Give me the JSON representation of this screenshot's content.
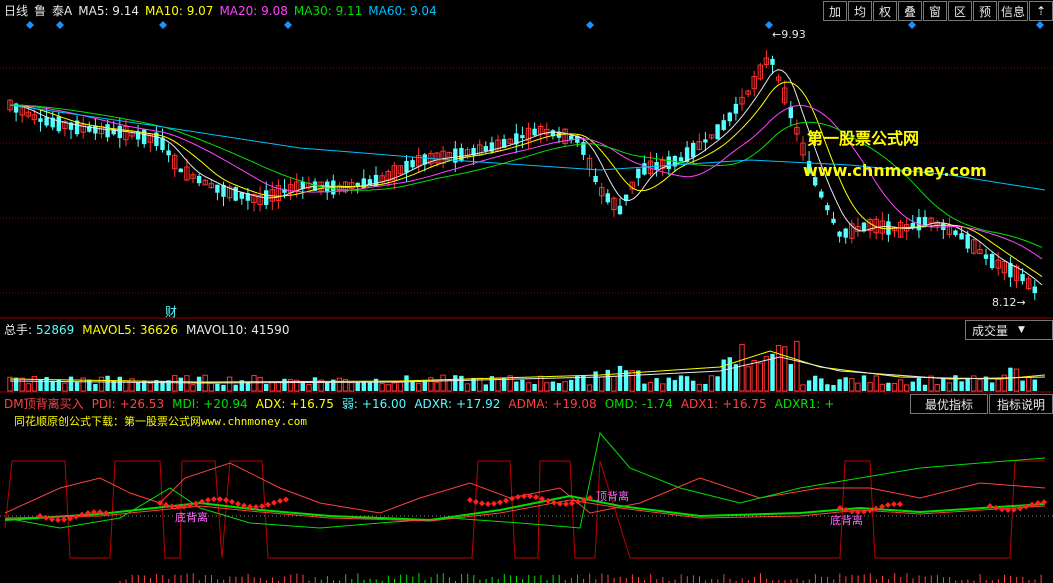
{
  "header": {
    "period": "日线",
    "stock_code": "鲁",
    "stock_name": "泰A",
    "ma": [
      {
        "label": "MA5:",
        "value": "9.14",
        "color": "#e8e8e8"
      },
      {
        "label": "MA10:",
        "value": "9.07",
        "color": "#ffff00"
      },
      {
        "label": "MA20:",
        "value": "9.08",
        "color": "#ff44ff"
      },
      {
        "label": "MA30:",
        "value": "9.11",
        "color": "#00e000"
      },
      {
        "label": "MA60:",
        "value": "9.04",
        "color": "#00c0ff"
      }
    ]
  },
  "toolbar": {
    "buttons": [
      "加",
      "均",
      "权",
      "叠",
      "窗",
      "区",
      "预",
      "信息"
    ]
  },
  "price_chart": {
    "high_label": "9.93",
    "low_label": "8.12",
    "finance_marker": "财",
    "watermark_title": "第一股票公式网",
    "watermark_url": "www.chnmoney.com"
  },
  "volume_panel": {
    "label": "总手:",
    "value": "52869",
    "mavol5_label": "MAVOL5:",
    "mavol5_value": "36626",
    "mavol10_label": "MAVOL10:",
    "mavol10_value": "41590",
    "selector": "成交量"
  },
  "indicator_panel": {
    "title": "DM顶背离买入",
    "pdi_label": "PDI:",
    "pdi_value": "+26.53",
    "mdi_label": "MDI:",
    "mdi_value": "+20.94",
    "adx_label": "ADX:",
    "adx_value": "+16.75",
    "weak_label": "弱:",
    "weak_value": "+16.00",
    "adxr_label": "ADXR:",
    "adxr_value": "+17.92",
    "adma_label": "ADMA:",
    "adma_value": "+19.08",
    "omd_label": "OMD:",
    "omd_value": "-1.74",
    "adx1_label": "ADX1:",
    "adx1_value": "+16.75",
    "adxr1_label": "ADXR1:",
    "adxr1_value": "+",
    "best_button": "最优指标",
    "help_button": "指标说明",
    "source_text": "同花顺原创公式下载：第一股票公式网www.chnmoney.com",
    "divergence_labels": [
      "底背离",
      "顶背离",
      "底背离"
    ]
  },
  "colors": {
    "up": "#ff3232",
    "down": "#54ffff",
    "grid": "#8b0000",
    "diamond": "#1e90ff"
  }
}
